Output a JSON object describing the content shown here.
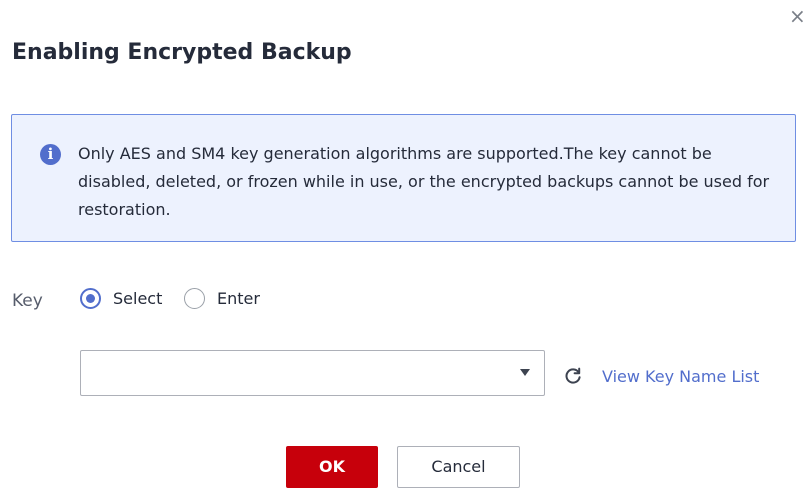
{
  "dialog": {
    "title": "Enabling Encrypted Backup",
    "close_label": "×"
  },
  "notice": {
    "icon": "info-icon",
    "icon_glyph": "i",
    "text": "Only AES and SM4 key generation algorithms are supported.The key cannot be disabled, deleted, or frozen while in use, or the encrypted backups cannot be used for restoration."
  },
  "form": {
    "key_label": "Key",
    "radio_options": [
      {
        "label": "Select",
        "checked": true
      },
      {
        "label": "Enter",
        "checked": false
      }
    ],
    "key_select": {
      "value": ""
    },
    "refresh_icon": "refresh-icon",
    "view_link_label": "View Key Name List"
  },
  "actions": {
    "ok_label": "OK",
    "cancel_label": "Cancel"
  },
  "colors": {
    "primary": "#c7000b",
    "accent": "#526ecc",
    "notice_bg": "#edf2fe",
    "notice_border": "#6f8ee3"
  }
}
